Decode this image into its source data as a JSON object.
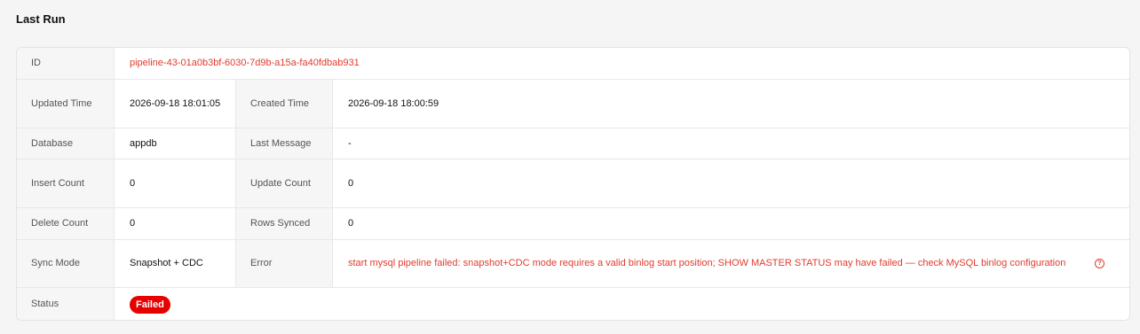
{
  "section_title": "Last Run",
  "rows": {
    "id": {
      "label": "ID",
      "value": "pipeline-43-01a0b3bf-6030-7d9b-a15a-fa40fdbab931"
    },
    "updated_time": {
      "label": "Updated Time",
      "value": "2026-09-18 18:01:05"
    },
    "created_time": {
      "label": "Created Time",
      "value": "2026-09-18 18:00:59"
    },
    "database": {
      "label": "Database",
      "value": "appdb"
    },
    "last_message": {
      "label": "Last Message",
      "value": "-"
    },
    "insert_count": {
      "label": "Insert Count",
      "value": "0"
    },
    "update_count": {
      "label": "Update Count",
      "value": "0"
    },
    "delete_count": {
      "label": "Delete Count",
      "value": "0"
    },
    "rows_synced": {
      "label": "Rows Synced",
      "value": "0"
    },
    "sync_mode": {
      "label": "Sync Mode",
      "value": "Snapshot + CDC"
    },
    "error": {
      "label": "Error",
      "value": "start mysql pipeline failed: snapshot+CDC mode requires a valid binlog start position; SHOW MASTER STATUS may have failed — check MySQL binlog configuration",
      "icon": "help-circle-icon"
    },
    "status": {
      "label": "Status",
      "value": "Failed"
    }
  },
  "colors": {
    "error_text": "#e23b2e",
    "status_failed": "#e60000"
  }
}
